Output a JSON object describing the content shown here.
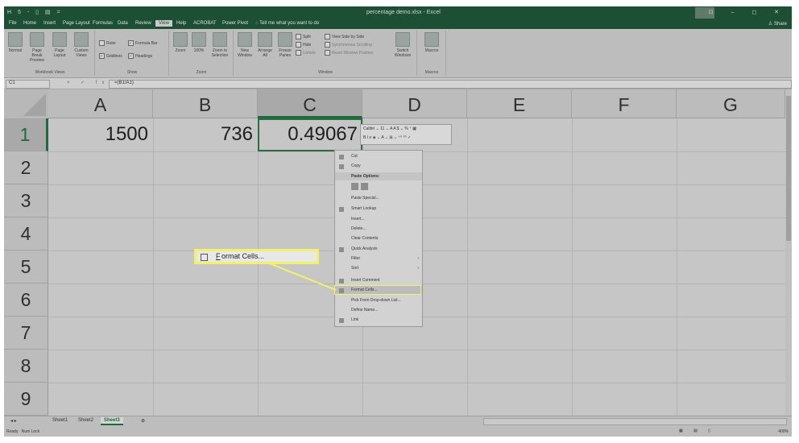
{
  "titlebar": {
    "doc_title": "percentage demo.xlsx - Excel",
    "qat": "H 5 - ▯ ▤ =",
    "window_controls": "⊡ – ◻ ✕"
  },
  "tabs": [
    "File",
    "Home",
    "Insert",
    "Page Layout",
    "Formulas",
    "Data",
    "Review",
    "View",
    "Help",
    "ACROBAT",
    "Power Pivot",
    "Tell me what you want to do"
  ],
  "active_tab": "View",
  "share": "Share",
  "ribbon": {
    "workbook_views": {
      "label": "Workbook Views",
      "buttons": [
        "Normal",
        "Page Break Preview",
        "Page Layout",
        "Custom Views"
      ]
    },
    "show": {
      "label": "Show",
      "checks": [
        "Ruler",
        "Formula Bar",
        "Gridlines",
        "Headings"
      ]
    },
    "zoom": {
      "label": "Zoom",
      "buttons": [
        "Zoom",
        "100%",
        "Zoom to Selection"
      ]
    },
    "window": {
      "label": "Window",
      "buttons": [
        "New Window",
        "Arrange All",
        "Freeze Panes",
        "Split",
        "Hide",
        "Unhide",
        "View Side by Side",
        "Synchronous Scrolling",
        "Reset Window Position",
        "Switch Windows"
      ]
    },
    "macros": {
      "label": "Macros",
      "buttons": [
        "Macros"
      ]
    }
  },
  "formula_bar": {
    "name_box": "C1",
    "fx": "× ✓ fx",
    "formula": "=(B1/A1)"
  },
  "columns": [
    "A",
    "B",
    "C",
    "D",
    "E",
    "F",
    "G"
  ],
  "rows": [
    "1",
    "2",
    "3",
    "4",
    "5",
    "6",
    "7",
    "8",
    "9"
  ],
  "cells": {
    "A1": "1500",
    "B1": "736",
    "C1": "0.49067"
  },
  "mini_toolbar": {
    "line1": "Calibri  ⌄ 11  ⌄ A A $ ⌄ % ⁺ ▦",
    "line2": "B I ≡ ◈ ⌄ A ⌄ ⊞ ⌄ ⁺⁰ ⁰⁰ ✓"
  },
  "context_menu": {
    "cut": "Cut",
    "copy": "Copy",
    "paste_options": "Paste Options:",
    "paste_special": "Paste Special...",
    "smart_lookup": "Smart Lookup",
    "insert": "Insert...",
    "delete": "Delete...",
    "clear_contents": "Clear Contents",
    "quick_analysis": "Quick Analysis",
    "filter": "Filter",
    "sort": "Sort",
    "insert_comment": "Insert Comment",
    "format_cells": "Format Cells...",
    "pick_list": "Pick From Drop-down List...",
    "define_name": "Define Name...",
    "link": "Link"
  },
  "callout": {
    "underlined": "F",
    "rest": "ormat Cells..."
  },
  "sheets": [
    "Sheet1",
    "Sheet2",
    "Sheet3"
  ],
  "active_sheet": "Sheet3",
  "add_sheet": "⊕",
  "status": {
    "ready": "Ready",
    "num_lock": "Num Lock",
    "zoom": "400%"
  },
  "colors": {
    "excel_green": "#1c4f33",
    "highlight": "#f5f06a"
  }
}
